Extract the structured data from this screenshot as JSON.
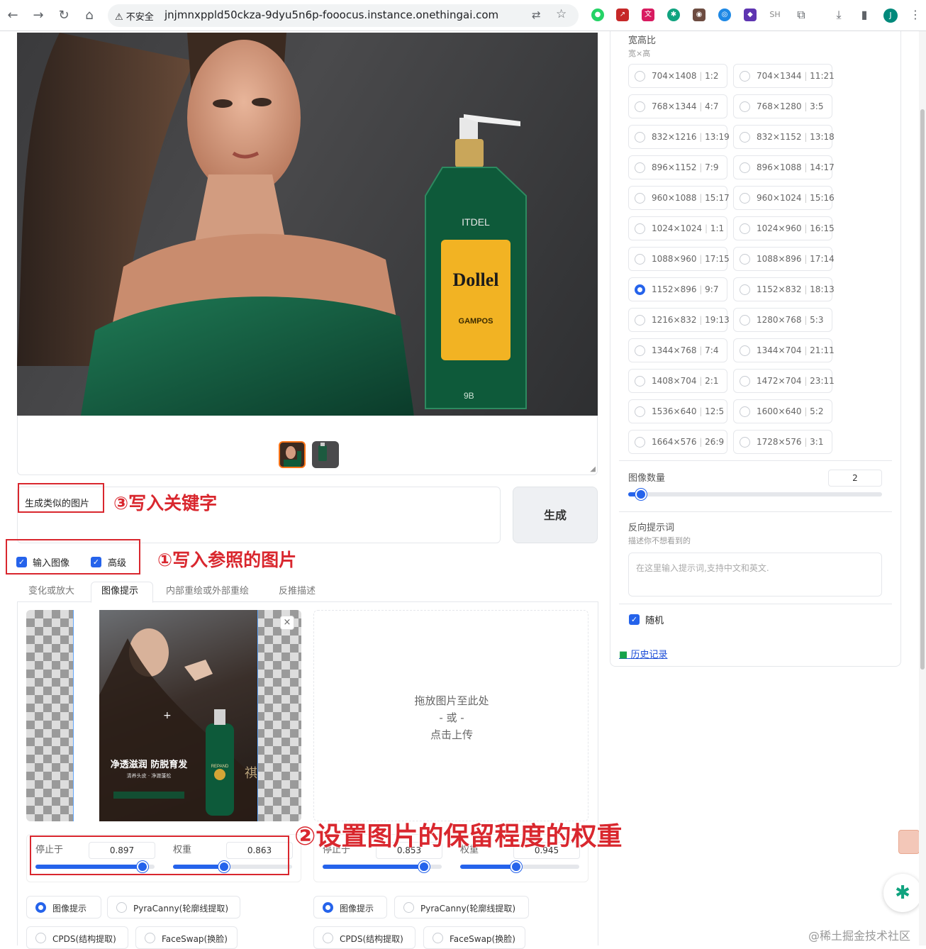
{
  "browser": {
    "insecure_label": "不安全",
    "url": "jnjmnxppld50ckza-9dyu5n6p-fooocus.instance.onethingai.com",
    "profile_initial": "J",
    "ext_sh_label": "SH"
  },
  "product": {
    "brand_top": "ITDEL",
    "brand_main": "Dollel",
    "brand_sub": "GAMPOS",
    "bottom": "9B"
  },
  "prompt": {
    "text": "生成类似的图片",
    "generate_label": "生成"
  },
  "checkboxes": {
    "input_image": "输入图像",
    "advanced": "高级"
  },
  "annotations": {
    "a1": "①写入参照的图片",
    "a2": "②设置图片的保留程度的权重",
    "a3": "③写入关键字"
  },
  "tabs": [
    {
      "label": "变化或放大"
    },
    {
      "label": "图像提示"
    },
    {
      "label": "内部重绘或外部重绘"
    },
    {
      "label": "反推描述"
    }
  ],
  "poster": {
    "headline": "净透滋润 防脱育发",
    "line": "清养头皮 · 净澈蓬松",
    "bottle": "REPAND",
    "side": "祺"
  },
  "drop": {
    "line1": "拖放图片至此处",
    "line2": "- 或 -",
    "line3": "点击上传"
  },
  "image_prompts": [
    {
      "stop_label": "停止于",
      "stop_value": "0.897",
      "stop_frac": 0.897,
      "weight_label": "权重",
      "weight_value": "0.863",
      "weight_frac": 0.431
    },
    {
      "stop_label": "停止于",
      "stop_value": "0.853",
      "stop_frac": 0.853,
      "weight_label": "权重",
      "weight_value": "0.945",
      "weight_frac": 0.472
    }
  ],
  "modes": [
    "图像提示",
    "PyraCanny(轮廓线提取)",
    "CPDS(结构提取)",
    "FaceSwap(换脸)"
  ],
  "aspect": {
    "title": "宽高比",
    "subtitle": "宽×高",
    "options": [
      [
        "704×1408",
        "1:2"
      ],
      [
        "704×1344",
        "11:21"
      ],
      [
        "768×1344",
        "4:7"
      ],
      [
        "768×1280",
        "3:5"
      ],
      [
        "832×1216",
        "13:19"
      ],
      [
        "832×1152",
        "13:18"
      ],
      [
        "896×1152",
        "7:9"
      ],
      [
        "896×1088",
        "14:17"
      ],
      [
        "960×1088",
        "15:17"
      ],
      [
        "960×1024",
        "15:16"
      ],
      [
        "1024×1024",
        "1:1"
      ],
      [
        "1024×960",
        "16:15"
      ],
      [
        "1088×960",
        "17:15"
      ],
      [
        "1088×896",
        "17:14"
      ],
      [
        "1152×896",
        "9:7"
      ],
      [
        "1152×832",
        "18:13"
      ],
      [
        "1216×832",
        "19:13"
      ],
      [
        "1280×768",
        "5:3"
      ],
      [
        "1344×768",
        "7:4"
      ],
      [
        "1344×704",
        "21:11"
      ],
      [
        "1408×704",
        "2:1"
      ],
      [
        "1472×704",
        "23:11"
      ],
      [
        "1536×640",
        "12:5"
      ],
      [
        "1600×640",
        "5:2"
      ],
      [
        "1664×576",
        "26:9"
      ],
      [
        "1728×576",
        "3:1"
      ]
    ],
    "selected": "1152×896"
  },
  "image_count": {
    "label": "图像数量",
    "value": "2",
    "frac": 0.05
  },
  "negative": {
    "title": "反向提示词",
    "subtitle": "描述你不想看到的",
    "placeholder": "在这里输入提示词,支持中文和英文."
  },
  "random_label": "随机",
  "history_label": "历史记录",
  "watermark": "@稀土掘金技术社区",
  "colors": {
    "accent": "#2563eb",
    "annotation": "#d9272e"
  }
}
